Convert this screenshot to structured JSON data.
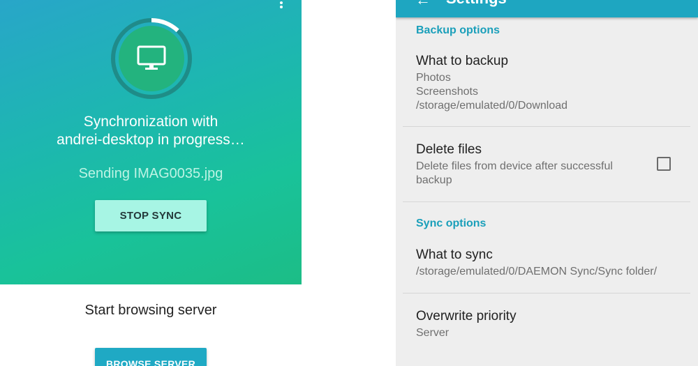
{
  "left": {
    "progress_fraction": 0.12,
    "sync_title_line1": "Synchronization with",
    "sync_title_line2": "andrei-desktop in progress…",
    "sending_text": "Sending IMAG0035.jpg",
    "stop_sync_label": "STOP SYNC",
    "browse_title": "Start browsing server",
    "browse_button_label": "BROWSE SERVER",
    "icons": {
      "device": "monitor-icon",
      "menu": "overflow-menu-icon"
    }
  },
  "settings": {
    "toolbar_title": "Settings",
    "backup_header": "Backup options",
    "what_to_backup_title": "What to backup",
    "what_to_backup_items": [
      "Photos",
      "Screenshots",
      "/storage/emulated/0/Download"
    ],
    "delete_files_title": "Delete files",
    "delete_files_summary_line1": "Delete files from device after successful",
    "delete_files_summary_line2": "backup",
    "delete_files_checked": false,
    "sync_header": "Sync options",
    "what_to_sync_title": "What to sync",
    "what_to_sync_summary": "/storage/emulated/0/DAEMON Sync/Sync folder/",
    "overwrite_title": "Overwrite priority",
    "overwrite_summary": "Server",
    "icons": {
      "back": "back-arrow-icon"
    }
  },
  "colors": {
    "accent": "#1ea6c1",
    "hero_gradient_start": "#28a6c9",
    "hero_gradient_end": "#1cbd86",
    "stop_button": "#a7f5e4",
    "progress_circle": "#23b37e"
  }
}
